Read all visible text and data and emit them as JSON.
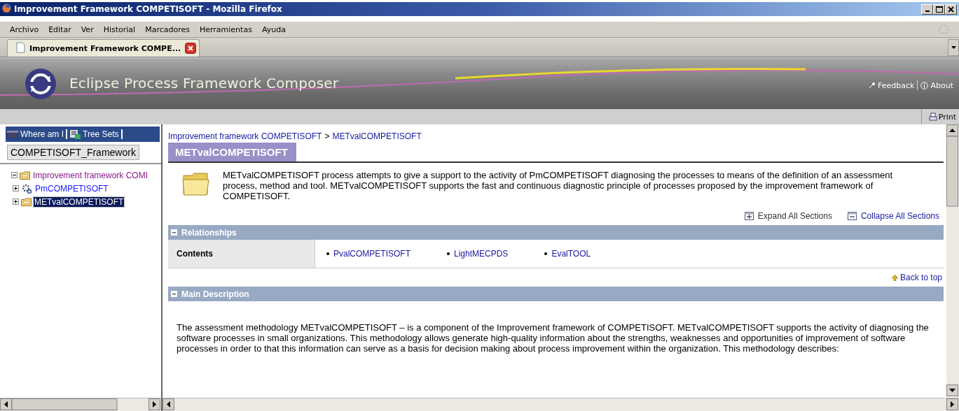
{
  "window": {
    "title": "Improvement Framework COMPETISOFT - Mozilla Firefox"
  },
  "menu": [
    "Archivo",
    "Editar",
    "Ver",
    "Historial",
    "Marcadores",
    "Herramientas",
    "Ayuda"
  ],
  "tabs": [
    {
      "label": "Improvement Framework COMPE...",
      "selected": true
    }
  ],
  "banner": {
    "title": "Eclipse Process Framework Composer",
    "links": [
      "Feedback",
      "About"
    ]
  },
  "toolbar": {
    "print": "Print"
  },
  "nav": {
    "tabs": [
      "Where am I",
      "Tree Sets"
    ],
    "view": "COMPETISOFT_Framework",
    "tree": [
      {
        "label": "Improvement framework COMI",
        "kind": "folder",
        "expanded": true,
        "selected": false,
        "children": [
          {
            "label": "PmCOMPETISOFT",
            "kind": "process",
            "expanded": false,
            "selected": false
          },
          {
            "label": "METvalCOMPETISOFT",
            "kind": "folder",
            "expanded": false,
            "selected": true
          }
        ]
      }
    ]
  },
  "content": {
    "breadcrumb": [
      "Improvement framework COMPETISOFT",
      "METvalCOMPETISOFT"
    ],
    "separator": ">",
    "title": "METvalCOMPETISOFT",
    "summary": "METvalCOMPETISOFT process attempts to give a support to the activity of PmCOMPETISOFT diagnosing the processes to means of the definition of an assessment process, method and tool. METvalCOMPETISOFT supports the fast and continuous diagnostic principle of processes proposed by the improvement framework of COMPETISOFT.",
    "expand_all": "Expand All Sections",
    "collapse_all": "Collapse All Sections",
    "relationships": {
      "title": "Relationships",
      "rows": [
        {
          "label": "Contents",
          "links": [
            "PvalCOMPETISOFT",
            "LightMECPDS",
            "EvalTOOL"
          ]
        }
      ]
    },
    "back_to_top": "Back to top",
    "main_description": {
      "title": "Main Description",
      "text": "The assessment methodology METvalCOMPETISOFT – is a component of the Improvement framework of COMPETISOFT. METvalCOMPETISOFT supports the activity of diagnosing the software processes in small organizations. This methodology allows generate high-quality information about the strengths, weaknesses and opportunities of improvement of software processes in order to that this information can serve as a basis for decision making about process improvement within the organization. This methodology describes:"
    }
  }
}
